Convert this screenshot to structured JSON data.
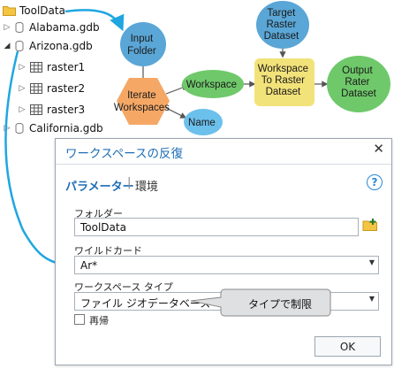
{
  "tree": {
    "root": "ToolData",
    "items": [
      {
        "label": "Alabama.gdb"
      },
      {
        "label": "Arizona.gdb"
      },
      {
        "label": "California.gdb"
      }
    ],
    "rasters": [
      "raster1",
      "raster2",
      "raster3"
    ]
  },
  "model": {
    "input_folder": [
      "Input",
      "Folder"
    ],
    "iterate": [
      "Iterate",
      "Workspaces"
    ],
    "workspace": "Workspace",
    "name": "Name",
    "target": [
      "Target",
      "Raster",
      "Dataset"
    ],
    "tool": [
      "Workspace",
      "To Raster",
      "Dataset"
    ],
    "output": [
      "Output",
      "Rater",
      "Dataset"
    ]
  },
  "dialog": {
    "title": "ワークスペースの反復",
    "close_label": "✕",
    "tab_params": "パラメーター",
    "tab_sep": "|",
    "tab_env": "環境",
    "help_label": "?",
    "folder_label": "フォルダー",
    "folder_value": "ToolData",
    "wildcard_label": "ワイルドカード",
    "wildcard_value": "Ar*",
    "wstype_label": "ワークスペース タイプ",
    "wstype_value": "ファイル ジオデータベース",
    "recursive_label": "再帰",
    "ok_label": "OK"
  },
  "callout": {
    "text": "タイプで制限"
  },
  "colors": {
    "accent": "#1d6db5",
    "arrow": "#1fa6e0",
    "data_node": "#5aa6d6",
    "tool_node": "#f5a866",
    "output_node": "#6fc96a",
    "name_node": "#6bc0ec",
    "tool_box": "#f2e27a"
  }
}
